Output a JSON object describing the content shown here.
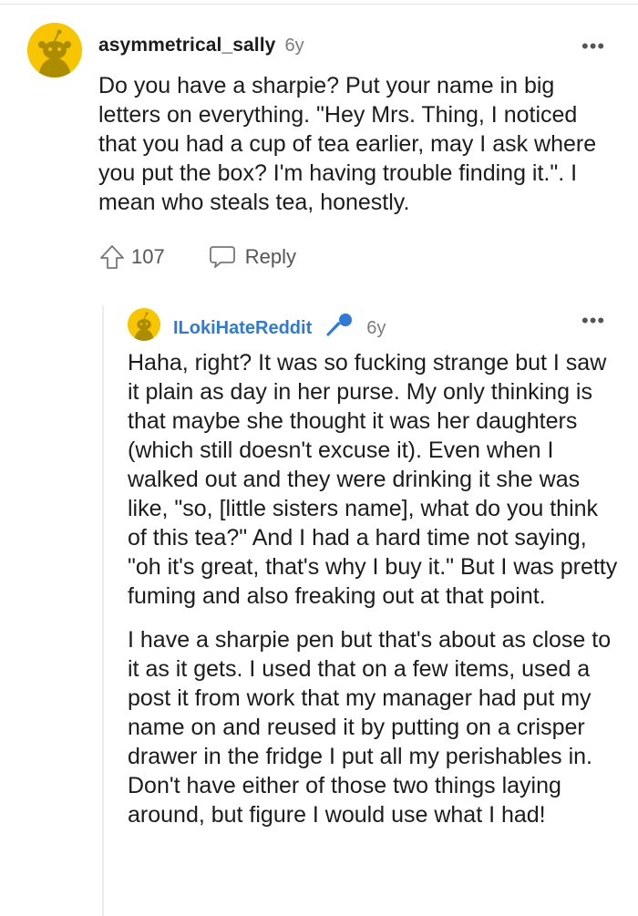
{
  "comment": {
    "author": "asymmetrical_sally",
    "age": "6y",
    "body": "Do you have a sharpie? Put your name in big letters on everything. \"Hey Mrs. Thing, I noticed that you had a cup of tea earlier, may I ask where you put the box? I'm having trouble finding it.\". I mean who steals tea, honestly.",
    "upvotes": "107",
    "reply_label": "Reply",
    "more_label": "•••"
  },
  "reply": {
    "author": "ILokiHateReddit",
    "age": "6y",
    "more_label": "•••",
    "paragraphs": [
      "Haha, right? It was so fucking strange but I saw it plain as day in her purse. My only thinking is that maybe she thought it was her daughters (which still doesn't excuse it). Even when I walked out and they were drinking it she was like, \"so, [little sisters name], what do you think of this tea?\" And I had a hard time not saying, \"oh it's great, that's why I buy it.\" But I was pretty fuming and also freaking out at that point.",
      "I have a sharpie pen but that's about as close to it as it gets. I used that on a few items, used a post it from work that my manager had put my name on and reused it by putting on a crisper drawer in the fridge I put all my perishables in. Don't have either of those two things laying around, but figure I would use what I had!"
    ]
  },
  "colors": {
    "avatar_bg": "#f7c600",
    "username_link": "#2f7ad8",
    "muted": "#7c7c7c"
  },
  "icons": {
    "upvote": "arrow-up-icon",
    "reply": "speech-bubble-icon",
    "flair": "microphone-icon",
    "more": "ellipsis-icon"
  }
}
